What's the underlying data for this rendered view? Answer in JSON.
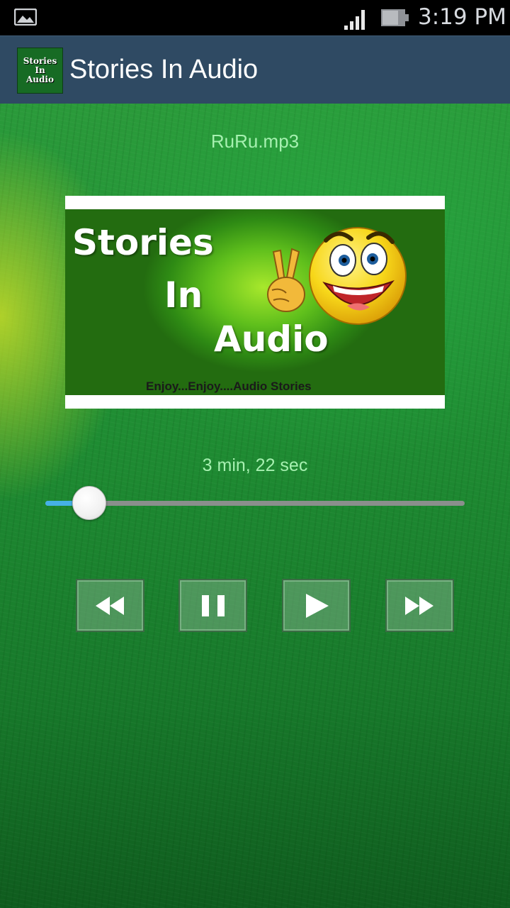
{
  "status_bar": {
    "time": "3:19 PM",
    "icons": [
      "image-notification-icon",
      "signal-icon",
      "battery-icon"
    ]
  },
  "action_bar": {
    "app_icon": {
      "lines": [
        "Stories",
        "In",
        "Audio"
      ]
    },
    "title": "Stories In Audio"
  },
  "player": {
    "file_name": "RuRu.mp3",
    "album_art": {
      "words": [
        "Stories",
        "In",
        "Audio"
      ],
      "tagline": "Enjoy...Enjoy....Audio  Stories"
    },
    "duration": "3 min, 22 sec",
    "progress_fraction": 0.105,
    "controls": [
      {
        "name": "rewind",
        "icon": "rewind-icon"
      },
      {
        "name": "pause",
        "icon": "pause-icon"
      },
      {
        "name": "play",
        "icon": "play-icon"
      },
      {
        "name": "fast-forward",
        "icon": "fast-forward-icon"
      }
    ]
  },
  "colors": {
    "action_bar": "#2f4a63",
    "accent_text": "#a6f0b0",
    "seek_fill": "#45b1e6"
  }
}
